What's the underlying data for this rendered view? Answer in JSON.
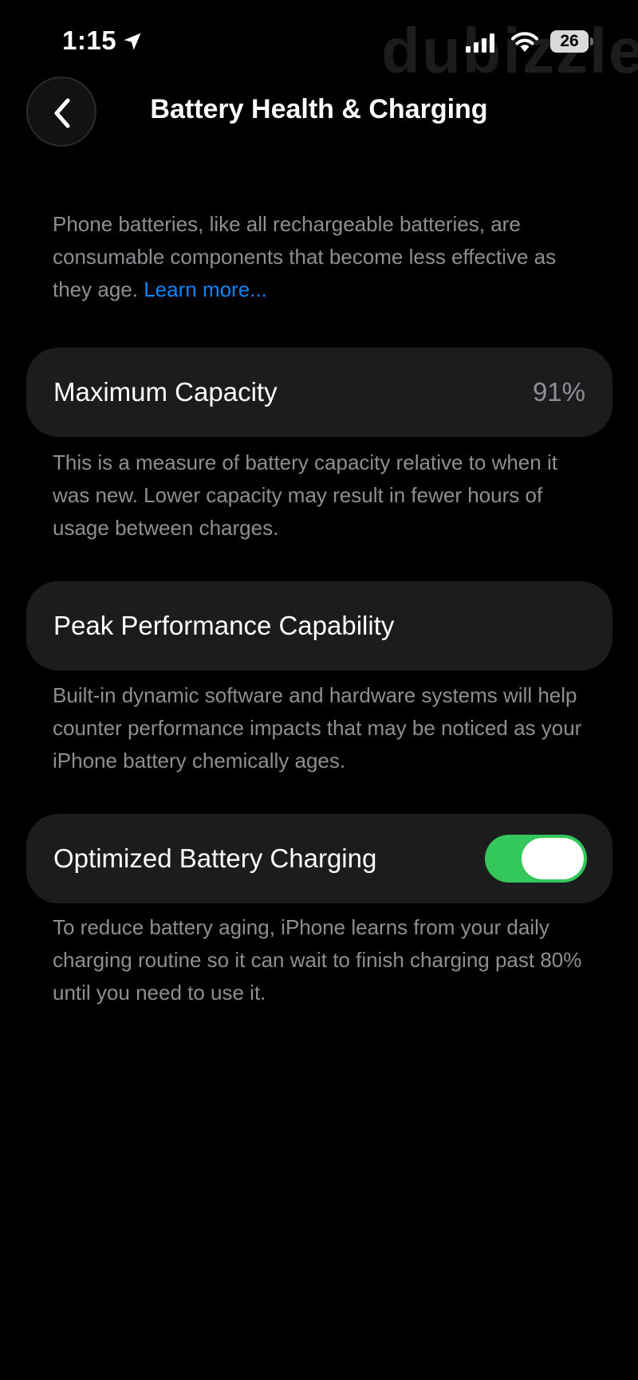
{
  "status_bar": {
    "time": "1:15",
    "battery_level": "26",
    "watermark": "dubizzle",
    "icons": [
      "location-arrow-icon",
      "cellular-signal-icon",
      "wifi-icon",
      "battery-icon"
    ]
  },
  "header": {
    "back_icon": "chevron-left-icon",
    "title": "Battery Health & Charging"
  },
  "intro": {
    "text": "Phone batteries, like all rechargeable batteries, are consumable components that become less effective as they age.",
    "link": "Learn more..."
  },
  "maximum_capacity": {
    "label": "Maximum Capacity",
    "value": "91%",
    "description": "This is a measure of battery capacity relative to when it was new. Lower capacity may result in fewer hours of usage between charges."
  },
  "peak_performance": {
    "label": "Peak Performance Capability",
    "description": "Built-in dynamic software and hardware systems will help counter performance impacts that may be noticed as your iPhone battery chemically ages."
  },
  "optimized_charging": {
    "label": "Optimized Battery Charging",
    "enabled": true,
    "description": "To reduce battery aging, iPhone learns from your daily charging routine so it can wait to finish charging past 80% until you need to use it."
  },
  "colors": {
    "background": "#000000",
    "card": "#1c1c1e",
    "secondary_text": "#8e8e93",
    "link": "#0a84ff",
    "toggle_on": "#34c759"
  }
}
